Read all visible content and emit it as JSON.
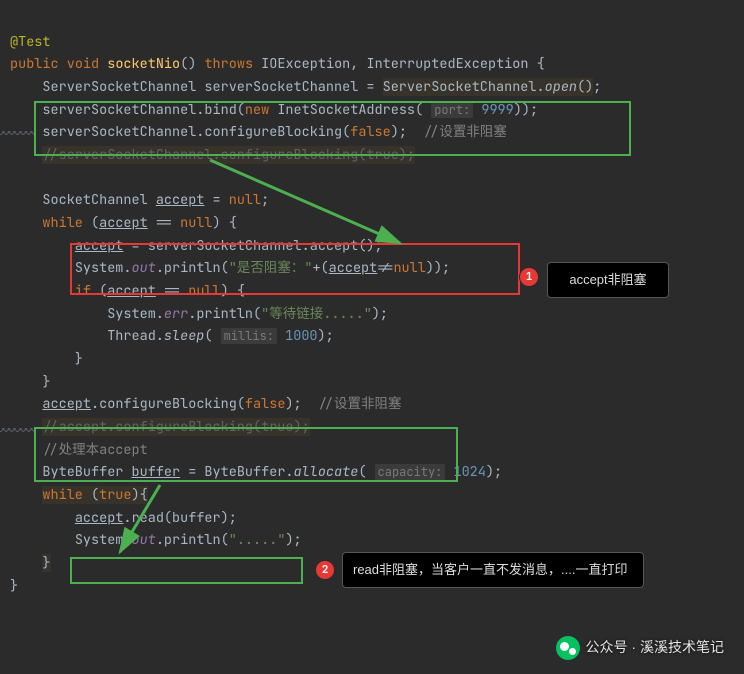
{
  "code": {
    "l1_ann": "@Test",
    "l2_pub": "public",
    "l2_void": "void",
    "l2_name": "socketNio",
    "l2_throws": "throws",
    "l2_ex1": "IOException",
    "l2_ex2": "InterruptedException",
    "l3_lhs": "ServerSocketChannel serverSocketChannel = ",
    "l3_class": "ServerSocketChannel",
    "l3_open": "open",
    "l4_pref": "serverSocketChannel.bind(",
    "l4_new": "new",
    "l4_type": "InetSocketAddress",
    "l4_hint": "port:",
    "l4_num": "9999",
    "l5_pref": "serverSocketChannel.configureBlocking(",
    "l5_false": "false",
    "l5_comment": "//设置非阻塞",
    "l6_commented": "//serverSocketChannel.configureBlocking(true);",
    "l8_decl1": "SocketChannel ",
    "l8_accept": "accept",
    "l8_eq": " = ",
    "l8_null": "null",
    "l9_while": "while",
    "l9_cond_a": "accept",
    "l9_cond_b": " == ",
    "l9_cond_null": "null",
    "l10_a": "accept",
    "l10_rest": " = serverSocketChannel.accept();",
    "l11_pref": "System.",
    "l11_out": "out",
    "l11_mid": ".println(",
    "l11_str": "\"是否阻塞：\"",
    "l11_plus": "+(",
    "l11_acc": "accept",
    "l11_neq": "!=",
    "l11_null": "null",
    "l11_end": "));",
    "l12_if": "if",
    "l12_acc": "accept",
    "l12_eq": " == ",
    "l12_null": "null",
    "l13_pref": "System.",
    "l13_err": "err",
    "l13_mid": ".println(",
    "l13_str": "\"等待链接.....\"",
    "l13_end": ");",
    "l14_pref": "Thread.",
    "l14_sleep": "sleep",
    "l14_hint": "millis:",
    "l14_num": "1000",
    "l17_acc": "accept",
    "l17_mid": ".configureBlocking(",
    "l17_false": "false",
    "l17_comment": "//设置非阻塞",
    "l18_commented": "//accept.configureBlocking(true);",
    "l19_comment": "//处理本accept",
    "l20_pref": "ByteBuffer ",
    "l20_var": "buffer",
    "l20_mid": " = ByteBuffer.",
    "l20_alloc": "allocate",
    "l20_hint": "capacity:",
    "l20_num": "1024",
    "l21_while": "while",
    "l21_true": "true",
    "l22_acc": "accept",
    "l22_read": ".read(buffer);",
    "l23_pref": "System.",
    "l23_out": "out",
    "l23_mid": ".println(",
    "l23_str": "\".....\"",
    "l23_end": ");"
  },
  "annotations": {
    "badge1": "1",
    "badge2": "2",
    "tooltip1": "accept非阻塞",
    "tooltip2": "read非阻塞，当客户一直不发消息，....一直打印",
    "watermark": "公众号 · 溪溪技术笔记"
  },
  "colors": {
    "green": "#4caf50",
    "red": "#e53935"
  }
}
